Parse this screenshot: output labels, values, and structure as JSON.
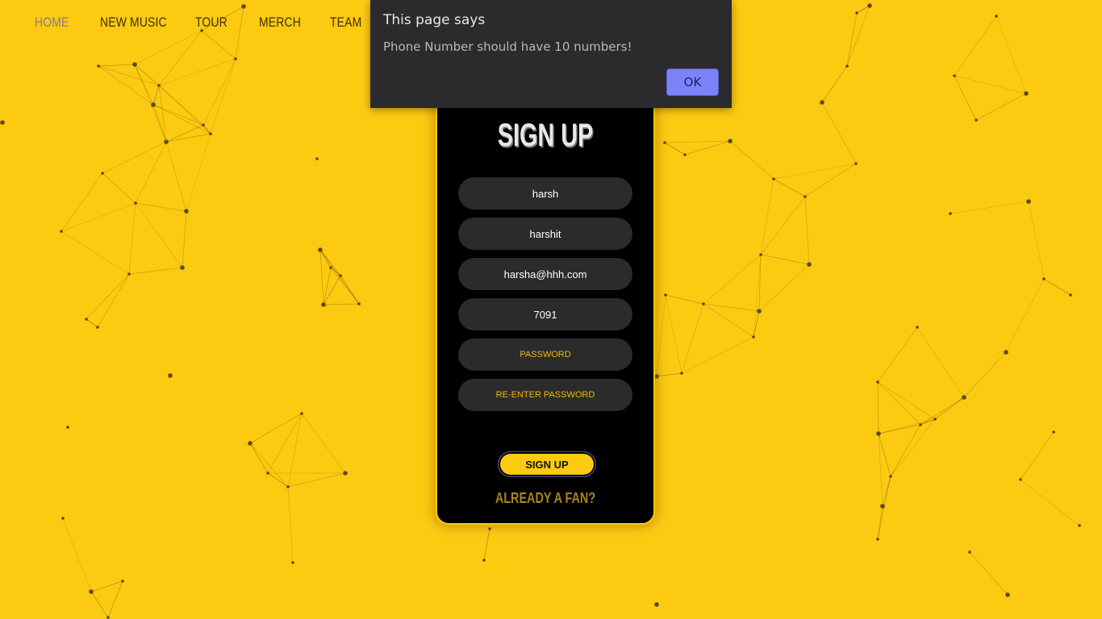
{
  "nav": {
    "items": [
      {
        "label": "Home",
        "active": true
      },
      {
        "label": "New Music",
        "active": false
      },
      {
        "label": "Tour",
        "active": false
      },
      {
        "label": "Merch",
        "active": false
      },
      {
        "label": "Team",
        "active": false
      }
    ]
  },
  "form": {
    "title": "SIGN UP",
    "fields": [
      {
        "value": "harsh",
        "type": "text"
      },
      {
        "value": "harshit",
        "type": "text"
      },
      {
        "value": "harsha@hhh.com",
        "type": "email"
      },
      {
        "value": "7091",
        "type": "tel"
      },
      {
        "placeholder": "Password",
        "type": "password"
      },
      {
        "placeholder": "Re-enter Password",
        "type": "password"
      }
    ],
    "submit_label": "Sign Up",
    "already_fan_label": "Already a fan?"
  },
  "dialog": {
    "title": "This page says",
    "message": "Phone Number should have 10 numbers!",
    "ok_label": "OK"
  },
  "colors": {
    "background": "#fdca12",
    "card": "#000000",
    "field": "#2b2b2b",
    "accent": "#f0b90b",
    "dialog_bg": "#2b2b2d",
    "dialog_button": "#7c83f8"
  }
}
